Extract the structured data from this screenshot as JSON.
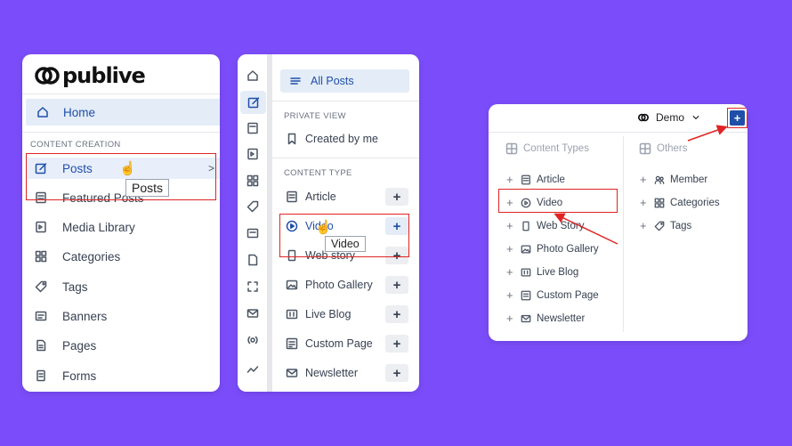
{
  "panel1": {
    "logo": "publive",
    "home": "Home",
    "section": "CONTENT CREATION",
    "items": [
      {
        "label": "Posts",
        "icon": "edit-icon"
      },
      {
        "label": "Featured Posts",
        "icon": "featured-icon"
      },
      {
        "label": "Media Library",
        "icon": "media-icon"
      },
      {
        "label": "Categories",
        "icon": "categories-icon"
      },
      {
        "label": "Tags",
        "icon": "tag-icon"
      },
      {
        "label": "Banners",
        "icon": "banner-icon"
      },
      {
        "label": "Pages",
        "icon": "page-icon"
      },
      {
        "label": "Forms",
        "icon": "form-icon"
      }
    ],
    "tooltip": "Posts"
  },
  "panel2": {
    "all_posts": "All Posts",
    "private_view": "PRIVATE VIEW",
    "created_by_me": "Created by me",
    "content_type": "CONTENT TYPE",
    "items": [
      {
        "label": "Article"
      },
      {
        "label": "Video"
      },
      {
        "label": "Web story"
      },
      {
        "label": "Photo Gallery"
      },
      {
        "label": "Live Blog"
      },
      {
        "label": "Custom Page"
      },
      {
        "label": "Newsletter"
      }
    ],
    "plus": "+",
    "tooltip": "Video"
  },
  "panel3": {
    "demo": "Demo",
    "add": "+",
    "content_types_head": "Content Types",
    "others_head": "Others",
    "content_types": [
      "Article",
      "Video",
      "Web Story",
      "Photo Gallery",
      "Live Blog",
      "Custom Page",
      "Newsletter"
    ],
    "others": [
      "Member",
      "Categories",
      "Tags"
    ],
    "plus": "+"
  },
  "colors": {
    "background": "#7b4dfa",
    "accent": "#1f4fa8",
    "highlight": "#e3ecf7",
    "annotation": "#e02424"
  }
}
